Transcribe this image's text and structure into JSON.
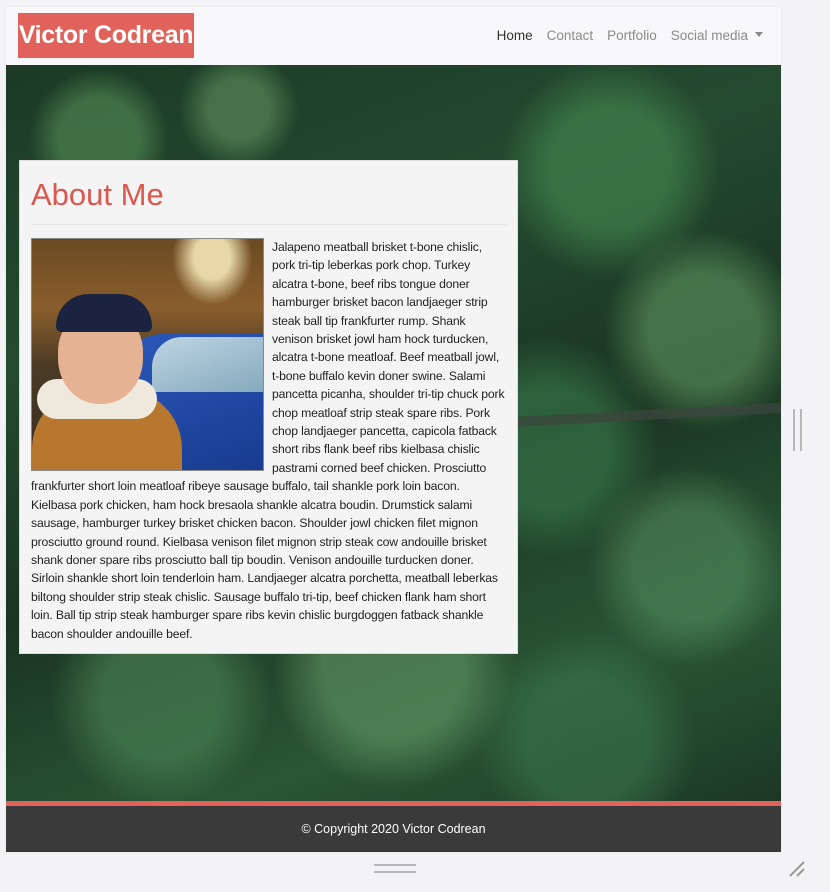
{
  "navbar": {
    "brand": "Victor Codrean",
    "links": [
      {
        "label": "Home",
        "active": true
      },
      {
        "label": "Contact"
      },
      {
        "label": "Portfolio"
      },
      {
        "label": "Social media",
        "dropdown": true
      }
    ]
  },
  "about": {
    "title": "About Me",
    "body": "Jalapeno meatball brisket t-bone chislic, pork tri-tip leberkas pork chop. Turkey alcatra t-bone, beef ribs tongue doner hamburger brisket bacon landjaeger strip steak ball tip frankfurter rump. Shank venison brisket jowl ham hock turducken, alcatra t-bone meatloaf. Beef meatball jowl, t-bone buffalo kevin doner swine. Salami pancetta picanha, shoulder tri-tip chuck pork chop meatloaf strip steak spare ribs. Pork chop landjaeger pancetta, capicola fatback short ribs flank beef ribs kielbasa chislic pastrami corned beef chicken. Prosciutto frankfurter short loin meatloaf ribeye sausage buffalo, tail shankle pork loin bacon. Kielbasa pork chicken, ham hock bresaola shankle alcatra boudin. Drumstick salami sausage, hamburger turkey brisket chicken bacon. Shoulder jowl chicken filet mignon prosciutto ground round. Kielbasa venison filet mignon strip steak cow andouille brisket shank doner spare ribs prosciutto ball tip boudin. Venison andouille turducken doner. Sirloin shankle short loin tenderloin ham. Landjaeger alcatra porchetta, meatball leberkas biltong shoulder strip steak chislic. Sausage buffalo tri-tip, beef chicken flank ham short loin. Ball tip strip steak hamburger spare ribs kevin chislic burgdoggen fatback shankle bacon shoulder andouille beef."
  },
  "footer": {
    "copyright": "© Copyright 2020 Victor Codrean"
  },
  "colors": {
    "accent": "#e0625a",
    "footer_bg": "#3b3a3a",
    "navbar_bg": "#f8f8fa"
  }
}
